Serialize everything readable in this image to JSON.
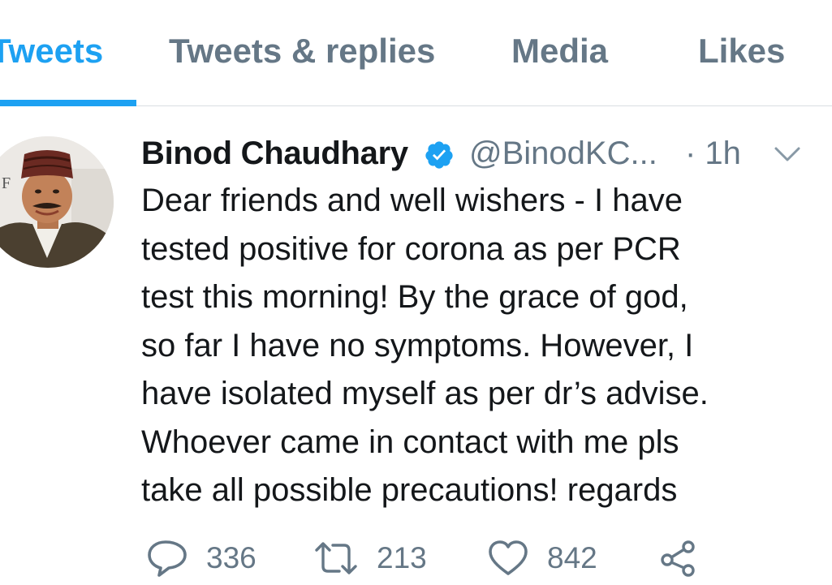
{
  "tabs": [
    {
      "label": "Tweets",
      "active": true
    },
    {
      "label": "Tweets & replies",
      "active": false
    },
    {
      "label": "Media",
      "active": false
    },
    {
      "label": "Likes",
      "active": false
    }
  ],
  "tweet": {
    "display_name": "Binod Chaudhary",
    "verified": true,
    "handle": "@BinodKC...",
    "time": "· 1h",
    "text_lines": [
      "Dear friends and well wishers - I have",
      "tested positive for corona as per PCR",
      "test this morning! By the grace of god,",
      "so far I have no symptoms. However, I",
      "have isolated myself as per dr’s advise.",
      "Whoever came in contact with me pls",
      "take all possible precautions! regards"
    ],
    "actions": {
      "replies": "336",
      "retweets": "213",
      "likes": "842"
    }
  },
  "icons": {
    "verified": "verified-badge-icon",
    "caret": "chevron-down-icon",
    "reply": "reply-bubble-icon",
    "retweet": "retweet-icon",
    "like": "heart-icon",
    "share": "share-icon"
  },
  "colors": {
    "accent": "#1da1f2",
    "secondary_text": "#657786",
    "primary_text": "#14171a",
    "divider": "#d9dee2"
  }
}
